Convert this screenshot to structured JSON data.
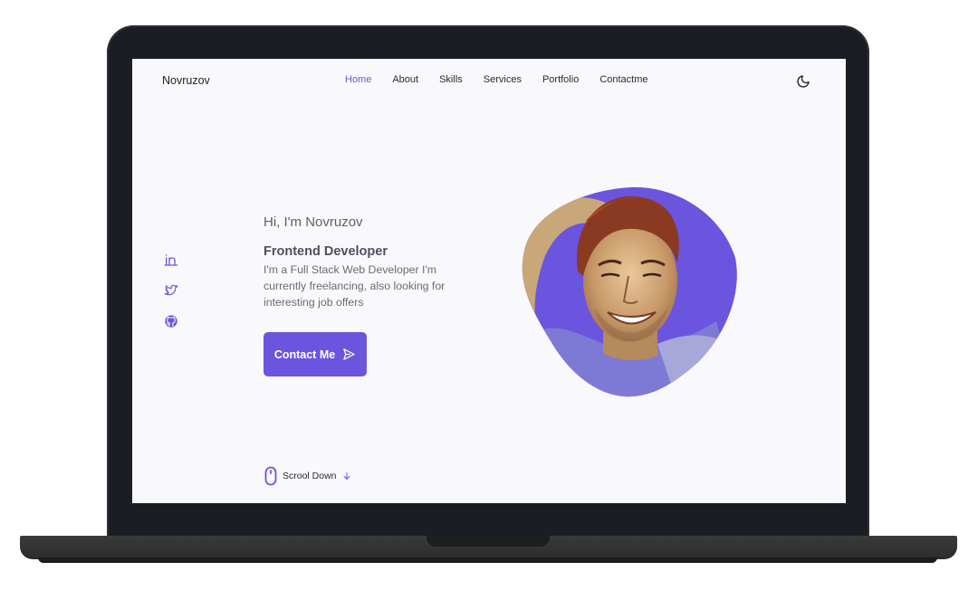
{
  "nav": {
    "logo": "Novruzov",
    "links": [
      {
        "label": "Home",
        "active": true
      },
      {
        "label": "About",
        "active": false
      },
      {
        "label": "Skills",
        "active": false
      },
      {
        "label": "Services",
        "active": false
      },
      {
        "label": "Portfolio",
        "active": false
      },
      {
        "label": "Contactme",
        "active": false
      }
    ],
    "theme_icon": "moon-icon"
  },
  "social": [
    "linkedin-icon",
    "twitter-icon",
    "github-icon"
  ],
  "hero": {
    "greeting": "Hi, I'm Novruzov",
    "role": "Frontend Developer",
    "description": "I'm a Full Stack Web Developer I'm currently freelancing, also looking for interesting job offers",
    "cta_label": "Contact Me",
    "cta_icon": "send-icon"
  },
  "scroll": {
    "label": "Scrool Down",
    "icon": "mouse-icon",
    "arrow_icon": "arrow-down-icon"
  },
  "colors": {
    "accent": "#6b55df",
    "screen_bg": "#f9f8fc",
    "text_dark": "#2a2a33",
    "laptop_body": "#1a1e24"
  }
}
